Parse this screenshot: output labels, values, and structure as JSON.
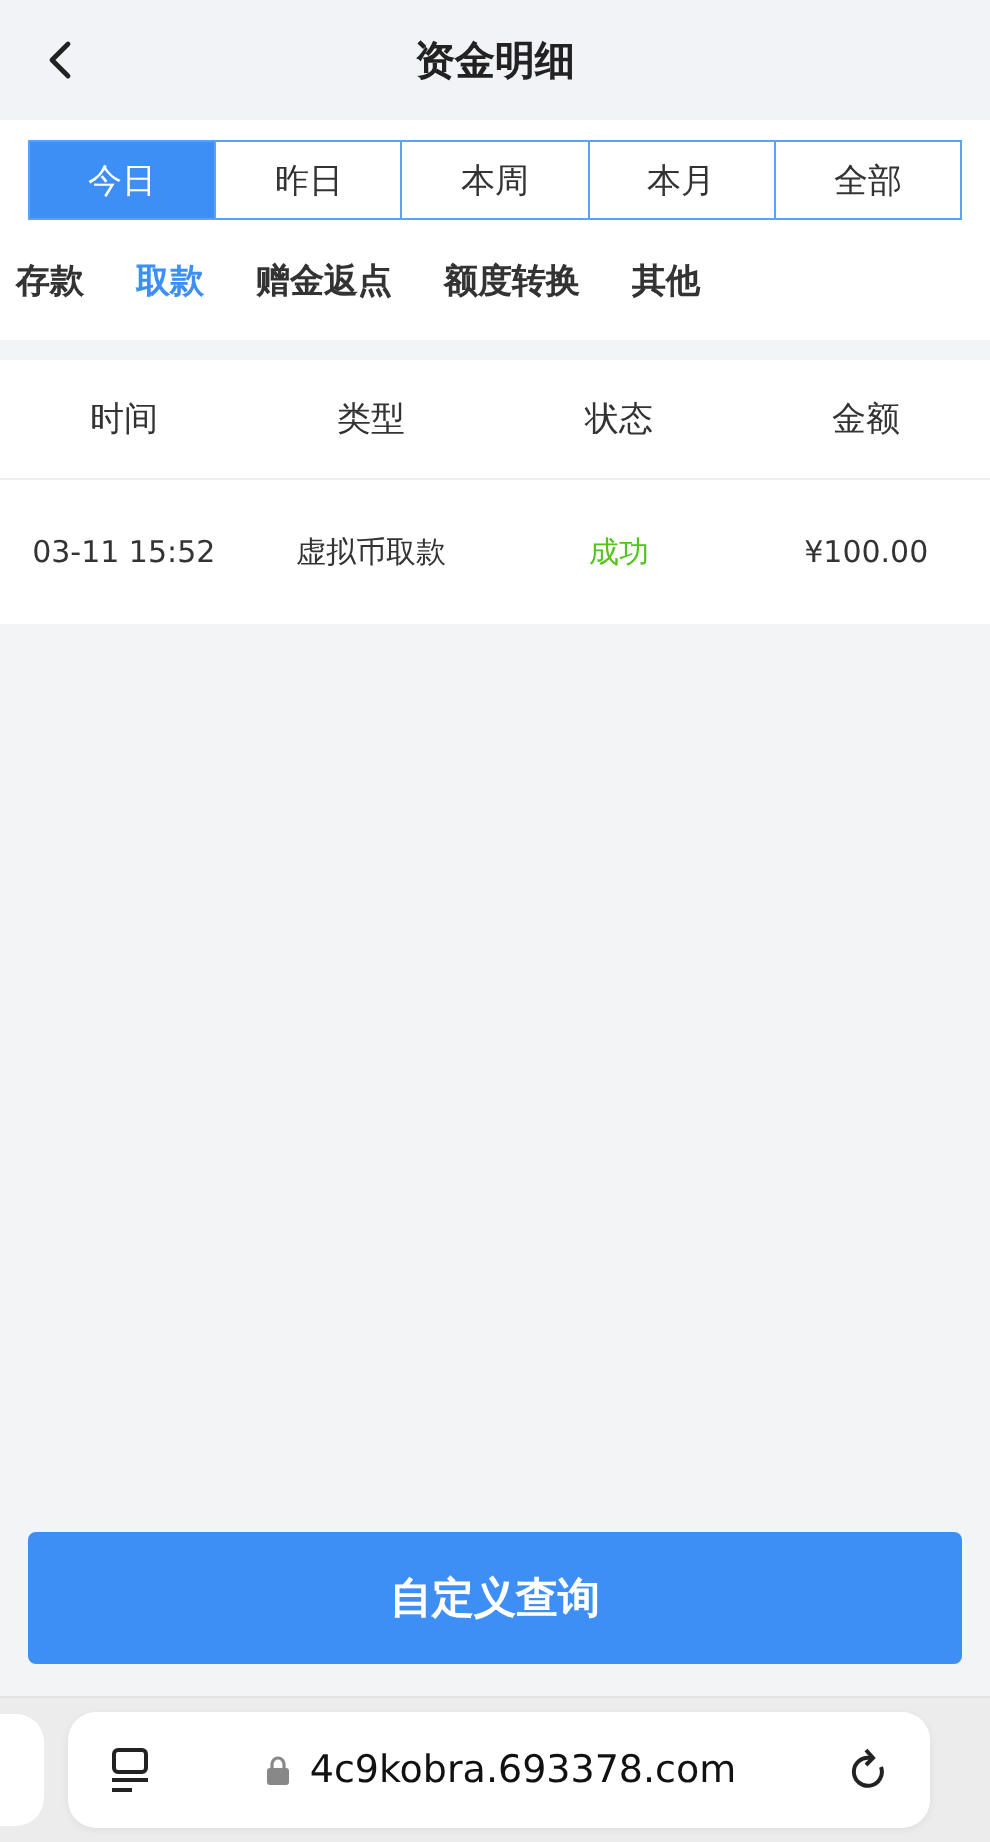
{
  "header": {
    "title": "资金明细"
  },
  "period_tabs": [
    {
      "label": "今日",
      "selected": true
    },
    {
      "label": "昨日",
      "selected": false
    },
    {
      "label": "本周",
      "selected": false
    },
    {
      "label": "本月",
      "selected": false
    },
    {
      "label": "全部",
      "selected": false
    }
  ],
  "category_tabs": [
    {
      "label": "存款",
      "selected": false
    },
    {
      "label": "取款",
      "selected": true
    },
    {
      "label": "赠金返点",
      "selected": false
    },
    {
      "label": "额度转换",
      "selected": false
    },
    {
      "label": "其他",
      "selected": false
    }
  ],
  "table": {
    "columns": [
      "时间",
      "类型",
      "状态",
      "金额"
    ],
    "rows": [
      {
        "time": "03-11 15:52",
        "type": "虚拟币取款",
        "status": "成功",
        "color": "#52c41a",
        "amount": "¥100.00"
      }
    ]
  },
  "query_button": "自定义查询",
  "browser_bar": {
    "url": "4c9kobra.693378.com"
  }
}
